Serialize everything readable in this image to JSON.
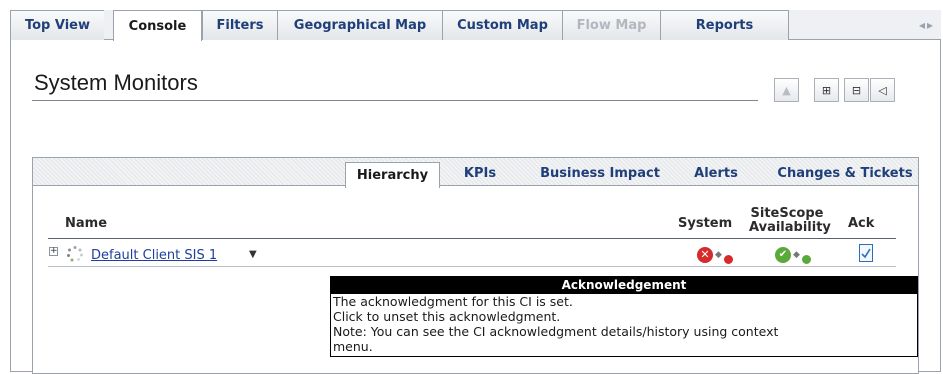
{
  "top_tabs": {
    "items": [
      {
        "label": "Top View"
      },
      {
        "label": "Console"
      },
      {
        "label": "Filters"
      },
      {
        "label": "Geographical Map"
      },
      {
        "label": "Custom Map"
      },
      {
        "label": "Flow Map"
      },
      {
        "label": "Reports"
      }
    ],
    "active": "Console",
    "disabled": [
      "Flow Map"
    ],
    "scroll_label": "◂▸"
  },
  "page": {
    "title": "System Monitors"
  },
  "toolbar": {
    "buttons": [
      {
        "icon": "up-arrow-icon",
        "label": "▲",
        "enabled": false
      },
      {
        "icon": "expand-tree-icon",
        "label": "⊞",
        "enabled": true
      },
      {
        "icon": "collapse-tree-icon",
        "label": "⊟",
        "enabled": true
      },
      {
        "icon": "sound-icon",
        "label": "◁",
        "enabled": true
      }
    ]
  },
  "sub_tabs": {
    "items": [
      {
        "label": "Hierarchy"
      },
      {
        "label": "KPIs"
      },
      {
        "label": "Business Impact"
      },
      {
        "label": "Alerts"
      },
      {
        "label": "Changes & Tickets"
      }
    ],
    "active": "Hierarchy"
  },
  "table": {
    "columns": {
      "name": "Name",
      "system": "System",
      "sitescope_line1": "SiteScope",
      "sitescope_line2": "Availability",
      "ack": "Ack"
    },
    "rows": [
      {
        "expand_label": "+",
        "name": "Default Client SIS 1",
        "dropdown_label": "▼",
        "system_status": "critical",
        "system_symbol": "✕",
        "system_trend": "◆",
        "sitescope_status": "ok",
        "sitescope_symbol": "✔",
        "sitescope_trend": "◆",
        "ack_icon": "acknowledgment-document-icon"
      }
    ]
  },
  "tooltip": {
    "title": "Acknowledgement",
    "lines": [
      "The acknowledgment for this CI is set.",
      "Click to unset this acknowledgment.",
      "Note: You can see the CI acknowledgment details/history using context",
      "menu."
    ]
  },
  "colors": {
    "link": "#1f3f9a",
    "tab_text": "#1f3f78",
    "critical": "#d52b2b",
    "ok": "#5aaa3a",
    "tooltip_header": "#000000"
  }
}
